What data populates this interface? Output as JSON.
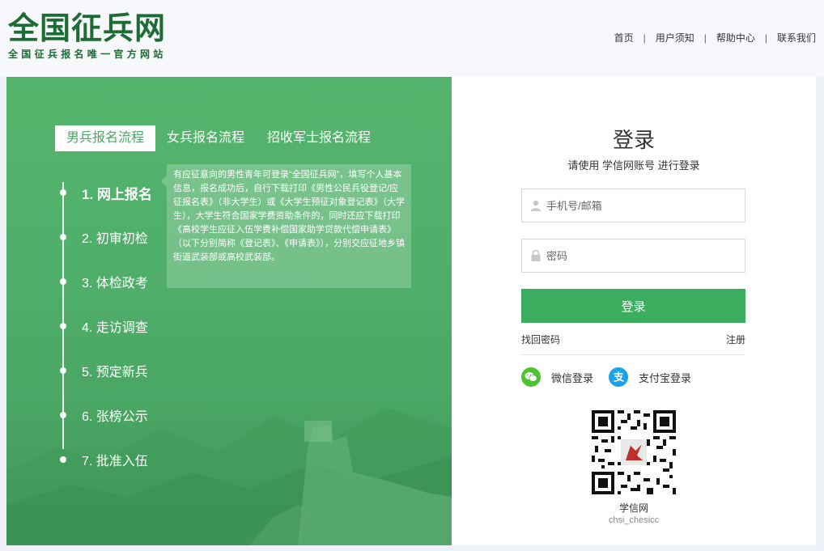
{
  "header": {
    "logo_title": "全国征兵网",
    "logo_subtitle": "全国征兵报名唯一官方网站",
    "nav": [
      "首页",
      "用户须知",
      "帮助中心",
      "联系我们"
    ],
    "nav_separator": "|"
  },
  "process": {
    "tabs": [
      "男兵报名流程",
      "女兵报名流程",
      "招收军士报名流程"
    ],
    "active_tab": "男兵报名流程",
    "steps": [
      "1. 网上报名",
      "2. 初审初检",
      "3. 体检政考",
      "4. 走访调查",
      "5. 预定新兵",
      "6. 张榜公示",
      "7. 批准入伍"
    ],
    "active_step": "1. 网上报名",
    "tooltip": "有应征意向的男性青年可登录“全国征兵网”，填写个人基本信息，报名成功后，自行下载打印《男性公民兵役登记/应征报名表》（非大学生）或《大学生预征对象登记表》（大学生），大学生符合国家学费资助条件的，同时还应下载打印《高校学生应征入伍学费补偿国家助学贷款代偿申请表》（以下分别简称《登记表》、《申请表》），分别交应征地乡镇街道武装部或高校武装部。"
  },
  "login": {
    "title": "登录",
    "subtitle": "请使用  学信网账号  进行登录",
    "username_placeholder": "手机号/邮箱",
    "password_placeholder": "密码",
    "submit_label": "登录",
    "forgot_password": "找回密码",
    "register": "注册",
    "wechat_login": "微信登录",
    "alipay_login": "支付宝登录",
    "qr_label": "学信网",
    "qr_subtitle": "chsi_chesicc"
  },
  "colors": {
    "brand_green": "#3aae5e",
    "panel_green": "#4fae69",
    "logo_green": "#1f6b34",
    "wechat_green": "#50c22f",
    "alipay_blue": "#1aa3e6"
  }
}
